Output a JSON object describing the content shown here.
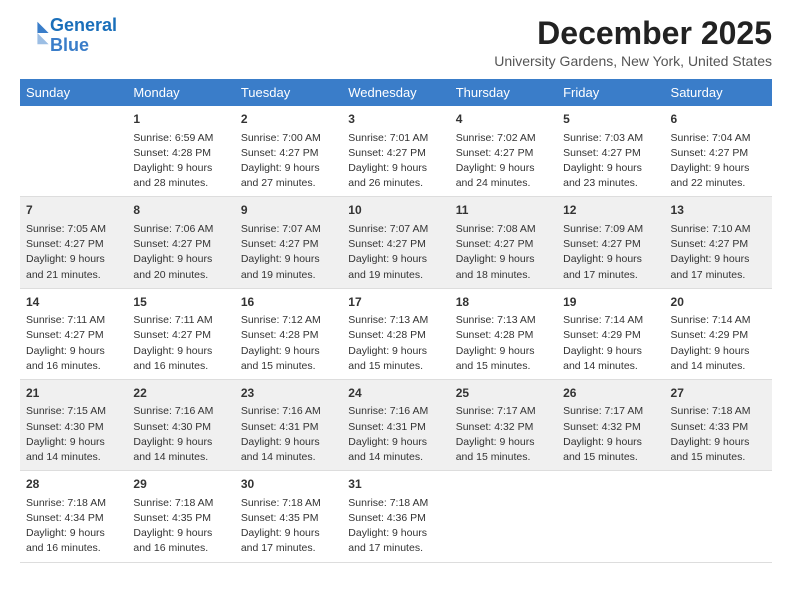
{
  "logo": {
    "text_general": "General",
    "text_blue": "Blue"
  },
  "title": "December 2025",
  "subtitle": "University Gardens, New York, United States",
  "days_header": [
    "Sunday",
    "Monday",
    "Tuesday",
    "Wednesday",
    "Thursday",
    "Friday",
    "Saturday"
  ],
  "weeks": [
    [
      {
        "num": "",
        "sunrise": "",
        "sunset": "",
        "daylight": ""
      },
      {
        "num": "1",
        "sunrise": "Sunrise: 6:59 AM",
        "sunset": "Sunset: 4:28 PM",
        "daylight": "Daylight: 9 hours and 28 minutes."
      },
      {
        "num": "2",
        "sunrise": "Sunrise: 7:00 AM",
        "sunset": "Sunset: 4:27 PM",
        "daylight": "Daylight: 9 hours and 27 minutes."
      },
      {
        "num": "3",
        "sunrise": "Sunrise: 7:01 AM",
        "sunset": "Sunset: 4:27 PM",
        "daylight": "Daylight: 9 hours and 26 minutes."
      },
      {
        "num": "4",
        "sunrise": "Sunrise: 7:02 AM",
        "sunset": "Sunset: 4:27 PM",
        "daylight": "Daylight: 9 hours and 24 minutes."
      },
      {
        "num": "5",
        "sunrise": "Sunrise: 7:03 AM",
        "sunset": "Sunset: 4:27 PM",
        "daylight": "Daylight: 9 hours and 23 minutes."
      },
      {
        "num": "6",
        "sunrise": "Sunrise: 7:04 AM",
        "sunset": "Sunset: 4:27 PM",
        "daylight": "Daylight: 9 hours and 22 minutes."
      }
    ],
    [
      {
        "num": "7",
        "sunrise": "Sunrise: 7:05 AM",
        "sunset": "Sunset: 4:27 PM",
        "daylight": "Daylight: 9 hours and 21 minutes."
      },
      {
        "num": "8",
        "sunrise": "Sunrise: 7:06 AM",
        "sunset": "Sunset: 4:27 PM",
        "daylight": "Daylight: 9 hours and 20 minutes."
      },
      {
        "num": "9",
        "sunrise": "Sunrise: 7:07 AM",
        "sunset": "Sunset: 4:27 PM",
        "daylight": "Daylight: 9 hours and 19 minutes."
      },
      {
        "num": "10",
        "sunrise": "Sunrise: 7:07 AM",
        "sunset": "Sunset: 4:27 PM",
        "daylight": "Daylight: 9 hours and 19 minutes."
      },
      {
        "num": "11",
        "sunrise": "Sunrise: 7:08 AM",
        "sunset": "Sunset: 4:27 PM",
        "daylight": "Daylight: 9 hours and 18 minutes."
      },
      {
        "num": "12",
        "sunrise": "Sunrise: 7:09 AM",
        "sunset": "Sunset: 4:27 PM",
        "daylight": "Daylight: 9 hours and 17 minutes."
      },
      {
        "num": "13",
        "sunrise": "Sunrise: 7:10 AM",
        "sunset": "Sunset: 4:27 PM",
        "daylight": "Daylight: 9 hours and 17 minutes."
      }
    ],
    [
      {
        "num": "14",
        "sunrise": "Sunrise: 7:11 AM",
        "sunset": "Sunset: 4:27 PM",
        "daylight": "Daylight: 9 hours and 16 minutes."
      },
      {
        "num": "15",
        "sunrise": "Sunrise: 7:11 AM",
        "sunset": "Sunset: 4:27 PM",
        "daylight": "Daylight: 9 hours and 16 minutes."
      },
      {
        "num": "16",
        "sunrise": "Sunrise: 7:12 AM",
        "sunset": "Sunset: 4:28 PM",
        "daylight": "Daylight: 9 hours and 15 minutes."
      },
      {
        "num": "17",
        "sunrise": "Sunrise: 7:13 AM",
        "sunset": "Sunset: 4:28 PM",
        "daylight": "Daylight: 9 hours and 15 minutes."
      },
      {
        "num": "18",
        "sunrise": "Sunrise: 7:13 AM",
        "sunset": "Sunset: 4:28 PM",
        "daylight": "Daylight: 9 hours and 15 minutes."
      },
      {
        "num": "19",
        "sunrise": "Sunrise: 7:14 AM",
        "sunset": "Sunset: 4:29 PM",
        "daylight": "Daylight: 9 hours and 14 minutes."
      },
      {
        "num": "20",
        "sunrise": "Sunrise: 7:14 AM",
        "sunset": "Sunset: 4:29 PM",
        "daylight": "Daylight: 9 hours and 14 minutes."
      }
    ],
    [
      {
        "num": "21",
        "sunrise": "Sunrise: 7:15 AM",
        "sunset": "Sunset: 4:30 PM",
        "daylight": "Daylight: 9 hours and 14 minutes."
      },
      {
        "num": "22",
        "sunrise": "Sunrise: 7:16 AM",
        "sunset": "Sunset: 4:30 PM",
        "daylight": "Daylight: 9 hours and 14 minutes."
      },
      {
        "num": "23",
        "sunrise": "Sunrise: 7:16 AM",
        "sunset": "Sunset: 4:31 PM",
        "daylight": "Daylight: 9 hours and 14 minutes."
      },
      {
        "num": "24",
        "sunrise": "Sunrise: 7:16 AM",
        "sunset": "Sunset: 4:31 PM",
        "daylight": "Daylight: 9 hours and 14 minutes."
      },
      {
        "num": "25",
        "sunrise": "Sunrise: 7:17 AM",
        "sunset": "Sunset: 4:32 PM",
        "daylight": "Daylight: 9 hours and 15 minutes."
      },
      {
        "num": "26",
        "sunrise": "Sunrise: 7:17 AM",
        "sunset": "Sunset: 4:32 PM",
        "daylight": "Daylight: 9 hours and 15 minutes."
      },
      {
        "num": "27",
        "sunrise": "Sunrise: 7:18 AM",
        "sunset": "Sunset: 4:33 PM",
        "daylight": "Daylight: 9 hours and 15 minutes."
      }
    ],
    [
      {
        "num": "28",
        "sunrise": "Sunrise: 7:18 AM",
        "sunset": "Sunset: 4:34 PM",
        "daylight": "Daylight: 9 hours and 16 minutes."
      },
      {
        "num": "29",
        "sunrise": "Sunrise: 7:18 AM",
        "sunset": "Sunset: 4:35 PM",
        "daylight": "Daylight: 9 hours and 16 minutes."
      },
      {
        "num": "30",
        "sunrise": "Sunrise: 7:18 AM",
        "sunset": "Sunset: 4:35 PM",
        "daylight": "Daylight: 9 hours and 17 minutes."
      },
      {
        "num": "31",
        "sunrise": "Sunrise: 7:18 AM",
        "sunset": "Sunset: 4:36 PM",
        "daylight": "Daylight: 9 hours and 17 minutes."
      },
      {
        "num": "",
        "sunrise": "",
        "sunset": "",
        "daylight": ""
      },
      {
        "num": "",
        "sunrise": "",
        "sunset": "",
        "daylight": ""
      },
      {
        "num": "",
        "sunrise": "",
        "sunset": "",
        "daylight": ""
      }
    ]
  ]
}
